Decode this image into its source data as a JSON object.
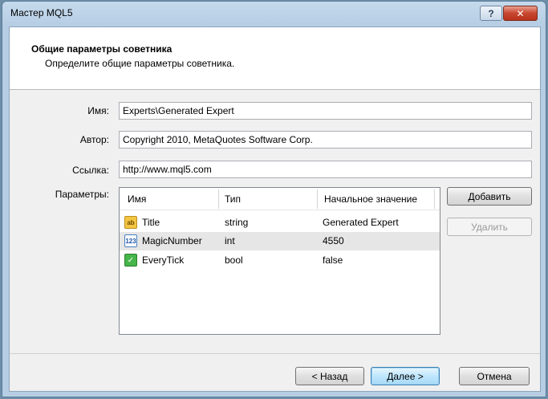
{
  "window": {
    "title": "Мастер MQL5",
    "help_label": "?",
    "close_label": "✕"
  },
  "header": {
    "title": "Общие параметры советника",
    "subtitle": "Определите общие параметры советника."
  },
  "form": {
    "name_label": "Имя:",
    "name_value": "Experts\\Generated Expert",
    "author_label": "Автор:",
    "author_value": "Copyright 2010, MetaQuotes Software Corp.",
    "link_label": "Ссылка:",
    "link_value": "http://www.mql5.com",
    "params_label": "Параметры:"
  },
  "params_table": {
    "columns": [
      "Имя",
      "Тип",
      "Начальное значение"
    ],
    "rows": [
      {
        "icon": "string-type-icon",
        "icon_text": "ab",
        "name": "Title",
        "type": "string",
        "value": "Generated Expert"
      },
      {
        "icon": "integer-type-icon",
        "icon_text": "123",
        "name": "MagicNumber",
        "type": "int",
        "value": "4550"
      },
      {
        "icon": "bool-type-icon",
        "icon_text": "✓",
        "name": "EveryTick",
        "type": "bool",
        "value": "false"
      }
    ]
  },
  "side_buttons": {
    "add": "Добавить",
    "delete": "Удалить"
  },
  "nav_buttons": {
    "back": "< Назад",
    "next": "Далее >",
    "cancel": "Отмена"
  }
}
